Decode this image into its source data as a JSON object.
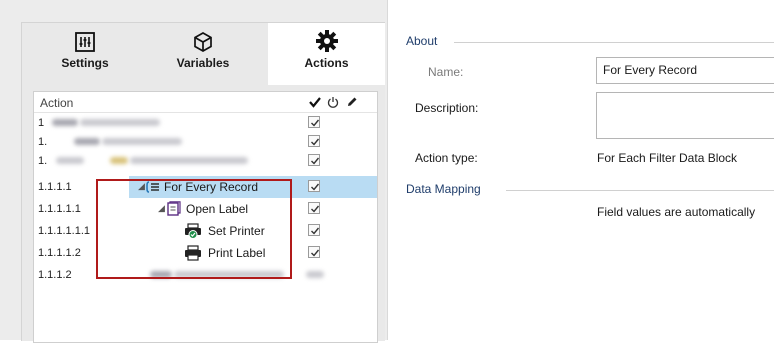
{
  "tabs": [
    {
      "label": "Settings",
      "icon": "sliders-icon"
    },
    {
      "label": "Variables",
      "icon": "cube-icon"
    },
    {
      "label": "Actions",
      "icon": "gear-icon"
    }
  ],
  "tree": {
    "header_action": "Action",
    "column_icons": [
      "checkmark-icon",
      "power-icon",
      "pencil-icon"
    ],
    "rows": [
      {
        "num": "1",
        "name": "",
        "checked": true,
        "obscured": true
      },
      {
        "num": "1.",
        "name": "",
        "checked": true,
        "obscured": true
      },
      {
        "num": "1.",
        "name": "",
        "checked": true,
        "obscured": true
      },
      {
        "num": "1.1.1.1",
        "name": "For Every Record",
        "checked": true,
        "selected": true
      },
      {
        "num": "1.1.1.1.1",
        "name": "Open Label",
        "checked": true
      },
      {
        "num": "1.1.1.1.1.1",
        "name": "Set Printer",
        "checked": true
      },
      {
        "num": "1.1.1.1.2",
        "name": "Print Label",
        "checked": true
      },
      {
        "num": "1.1.1.2",
        "name": "",
        "checked": false,
        "obscured": true
      }
    ]
  },
  "about": {
    "section_title": "About",
    "name_label": "Name:",
    "name_value": "For Every Record",
    "description_label": "Description:",
    "description_value": "",
    "action_type_label": "Action type:",
    "action_type_value": "For Each Filter Data Block"
  },
  "data_mapping": {
    "section_title": "Data Mapping",
    "note": "Field values are automatically"
  },
  "colors": {
    "selection": "#b9dcf3",
    "highlight_border": "#b01a1a",
    "section_title": "#1f3d6b"
  }
}
